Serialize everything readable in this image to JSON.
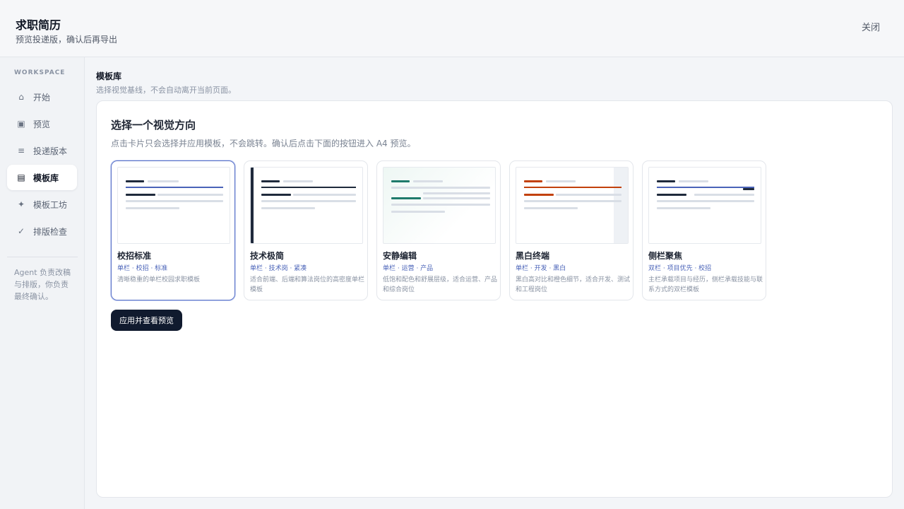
{
  "header": {
    "title": "求职简历",
    "subtitle": "预览投递版，确认后再导出",
    "close_label": "关闭"
  },
  "sidebar": {
    "section_label": "WORKSPACE",
    "items": [
      {
        "label": "开始",
        "icon": "home-icon",
        "glyph": "⌂"
      },
      {
        "label": "预览",
        "icon": "preview-icon",
        "glyph": "▣"
      },
      {
        "label": "投递版本",
        "icon": "list-icon",
        "glyph": "≡"
      },
      {
        "label": "模板库",
        "icon": "template-icon",
        "glyph": "▤",
        "active": true
      },
      {
        "label": "模板工坊",
        "icon": "sparkle-icon",
        "glyph": "✦"
      },
      {
        "label": "排版检查",
        "icon": "check-icon",
        "glyph": "✓"
      }
    ],
    "note": "Agent 负责改稿与排版，你负责最终确认。"
  },
  "main": {
    "section_title": "模板库",
    "section_subtitle": "选择视觉基线，不会自动离开当前页面。",
    "panel_title": "选择一个视觉方向",
    "panel_desc": "点击卡片只会选择并应用模板，不会跳转。确认后点击下面的按钮进入 A4 预览。",
    "templates": [
      {
        "name": "校招标准",
        "tags": "单栏 · 校招 · 标准",
        "desc": "清晰稳重的单栏校园求职模板",
        "accent": "#4a63b8",
        "selected": true
      },
      {
        "name": "技术极简",
        "tags": "单栏 · 技术岗 · 紧凑",
        "desc": "适合前端、后端和算法岗位的高密度单栏模板",
        "accent": "#1f2a3c"
      },
      {
        "name": "安静编辑",
        "tags": "单栏 · 运营 · 产品",
        "desc": "低饱和配色和舒展层级，适合运营、产品和综合岗位",
        "accent": "#1f7a6b"
      },
      {
        "name": "黑白终端",
        "tags": "单栏 · 开发 · 黑白",
        "desc": "黑白高对比和橙色细节，适合开发、测试和工程岗位",
        "accent": "#c2410c"
      },
      {
        "name": "侧栏聚焦",
        "tags": "双栏 · 项目优先 · 校招",
        "desc": "主栏承载项目与经历，侧栏承载技能与联系方式的双栏模板",
        "accent": "#4a63b8"
      }
    ],
    "apply_label": "应用并查看预览"
  }
}
